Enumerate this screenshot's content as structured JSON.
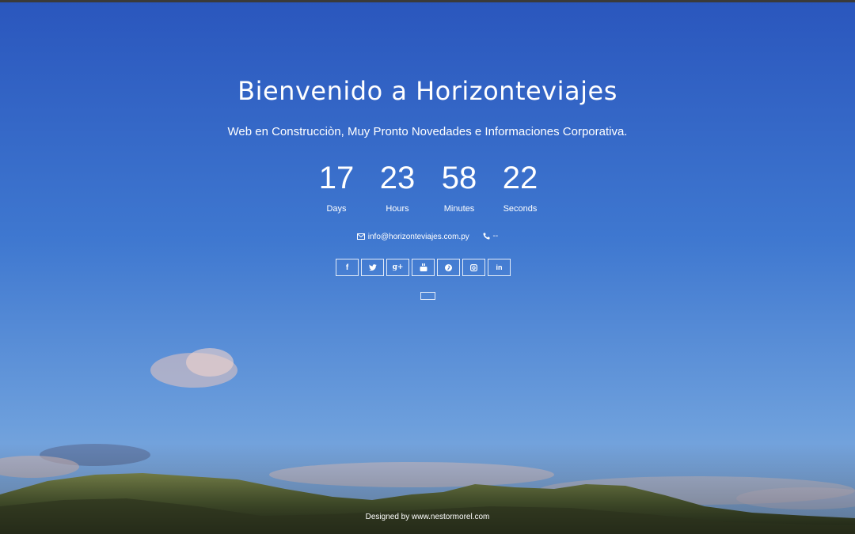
{
  "header": {
    "title": "Bienvenido a Horizonteviajes",
    "subtitle": "Web en Construcciòn, Muy Pronto Novedades e Informaciones Corporativa."
  },
  "countdown": {
    "days": {
      "value": "17",
      "label": "Days"
    },
    "hours": {
      "value": "23",
      "label": "Hours"
    },
    "minutes": {
      "value": "58",
      "label": "Minutes"
    },
    "seconds": {
      "value": "22",
      "label": "Seconds"
    }
  },
  "contact": {
    "email": "info@horizonteviajes.com.py",
    "phone": "--",
    "email_icon": "envelope-icon",
    "phone_icon": "phone-icon"
  },
  "social": {
    "icons": [
      "facebook-icon",
      "twitter-icon",
      "google-plus-icon",
      "youtube-icon",
      "pinterest-icon",
      "instagram-icon",
      "linkedin-icon"
    ],
    "facebook_glyph": "f",
    "googleplus_glyph": "g+",
    "linkedin_glyph": "in"
  },
  "footer": {
    "credit": "Designed by www.nestormorel.com"
  },
  "colors": {
    "sky_top": "#2a58c0",
    "sky_bottom": "#5f95d8",
    "mountain": "#5a6a3e"
  }
}
